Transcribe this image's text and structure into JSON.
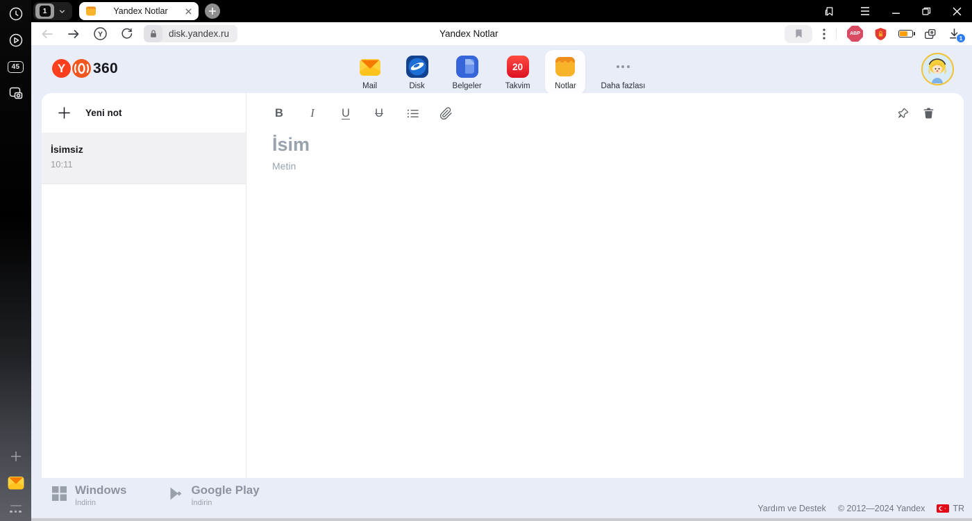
{
  "window": {
    "tab_group_count": "1",
    "tab_title": "Yandex Notlar"
  },
  "os_sidebar": {
    "tab_count_badge": "45"
  },
  "toolbar": {
    "url": "disk.yandex.ru",
    "page_title": "Yandex Notlar",
    "yandex_icon_letter": "Y",
    "adblock_label": "ABP",
    "download_badge": "1"
  },
  "header": {
    "logo_letter": "Y",
    "logo_text": "360",
    "apps": [
      {
        "label": "Mail"
      },
      {
        "label": "Disk"
      },
      {
        "label": "Belgeler"
      },
      {
        "label": "Takvim",
        "badge": "20"
      },
      {
        "label": "Notlar"
      },
      {
        "label": "Daha fazlası"
      }
    ]
  },
  "notes": {
    "new_note_label": "Yeni not",
    "items": [
      {
        "title": "İsimsiz",
        "time": "10:11"
      }
    ]
  },
  "editor": {
    "toolbar": {
      "bold": "B",
      "italic": "I",
      "underline": "U",
      "strikethrough": "U"
    },
    "title_placeholder": "İsim",
    "body_placeholder": "Metin"
  },
  "footer": {
    "windows": {
      "title": "Windows",
      "subtitle": "İndirin"
    },
    "google_play": {
      "title": "Google Play",
      "subtitle": "İndirin"
    },
    "help_link": "Yardım ve Destek",
    "copyright": "© 2012—2024 Yandex",
    "language": "TR"
  },
  "colors": {
    "page_background": "#e9edf8",
    "yandex_red": "#fc3f1d",
    "calendar_red": "#e31a28",
    "notes_orange": "#f6a723",
    "download_badge_blue": "#2b7cf6",
    "flag_red": "#e30a17"
  }
}
